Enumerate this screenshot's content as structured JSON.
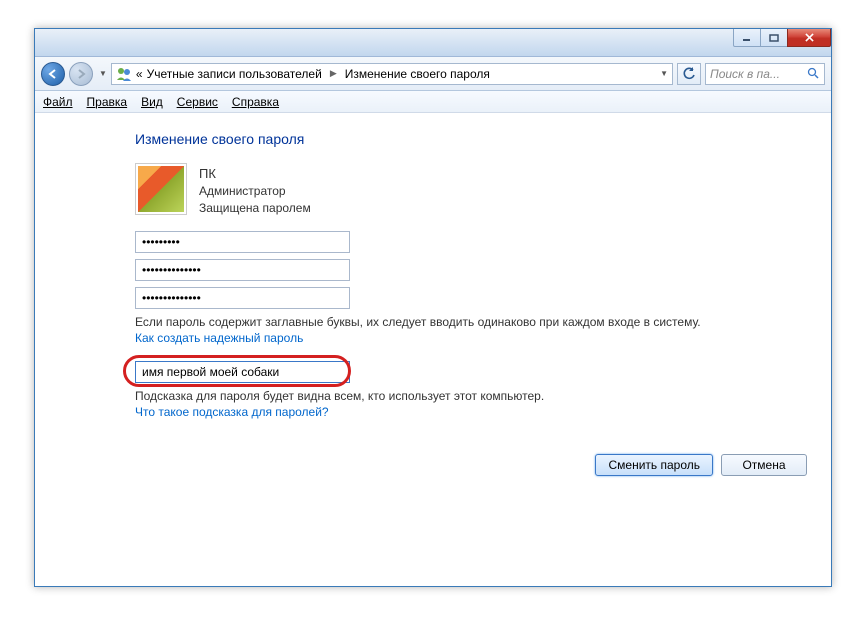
{
  "breadcrumbs": {
    "prefix": "«",
    "item1": "Учетные записи пользователей",
    "item2": "Изменение своего пароля"
  },
  "search": {
    "placeholder": "Поиск в па..."
  },
  "menu": {
    "file": "Файл",
    "edit": "Правка",
    "view": "Вид",
    "tools": "Сервис",
    "help": "Справка"
  },
  "page": {
    "title": "Изменение своего пароля"
  },
  "user": {
    "name": "ПК",
    "role": "Администратор",
    "status": "Защищена паролем"
  },
  "passwords": {
    "current": "•••••••••",
    "new": "••••••••••••••",
    "confirm": "••••••••••••••"
  },
  "caps_note": "Если пароль содержит заглавные буквы, их следует вводить одинаково при каждом входе в систему.",
  "link_strong_pw": "Как создать надежный пароль",
  "hint": {
    "value": "имя первой моей собаки",
    "note": "Подсказка для пароля будет видна всем, кто использует этот компьютер.",
    "link": "Что такое подсказка для паролей?"
  },
  "buttons": {
    "change": "Сменить пароль",
    "cancel": "Отмена"
  }
}
